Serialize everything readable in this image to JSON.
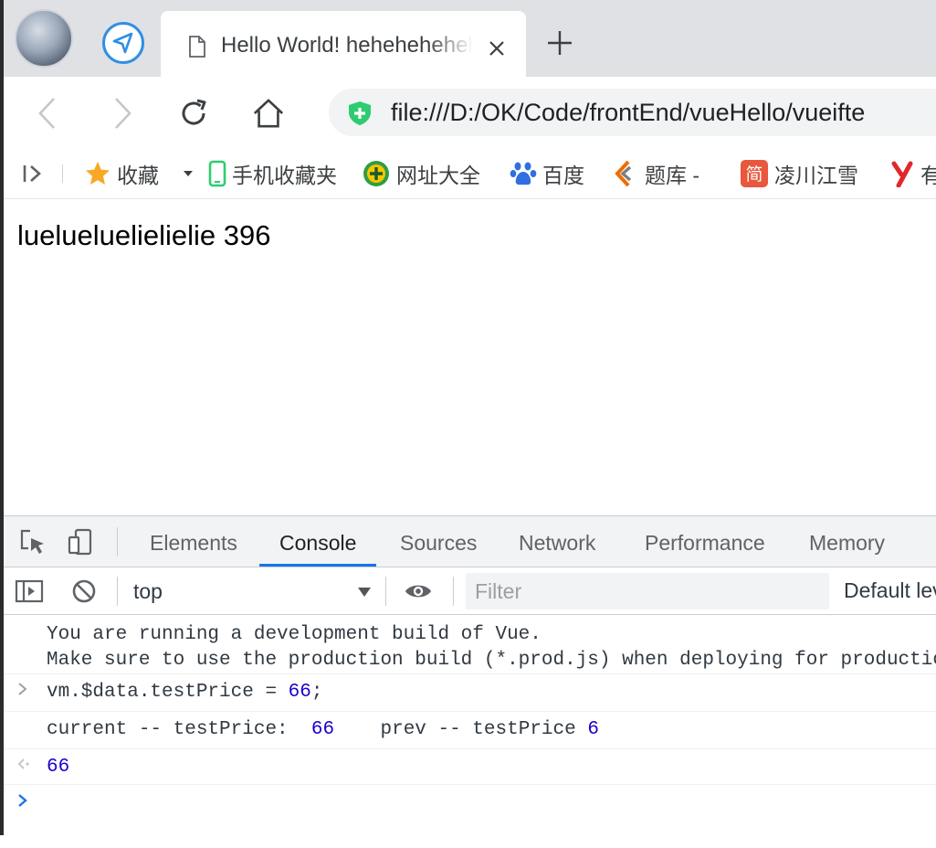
{
  "browser": {
    "tab": {
      "title": "Hello World! hehehehehehe"
    },
    "address_bar": {
      "url": "file:///D:/OK/Code/frontEnd/vueHello/vueifte"
    },
    "bookmarks": [
      {
        "label": "收藏",
        "icon": "star-icon"
      },
      {
        "label": "手机收藏夹",
        "icon": "phone-icon"
      },
      {
        "label": "网址大全",
        "icon": "globe-plus-icon"
      },
      {
        "label": "百度",
        "icon": "baidu-paw-icon"
      },
      {
        "label": "题库 -",
        "icon": "tiku-icon"
      },
      {
        "label": "凌川江雪",
        "icon": "jian-icon"
      },
      {
        "label": "有",
        "icon": "youdao-icon"
      }
    ],
    "colors": {
      "accent": "#1a73e8",
      "nav_blue": "#2f8fe6",
      "shield_green": "#2ecc71"
    }
  },
  "page": {
    "text": "luelueluelielielie 396"
  },
  "devtools": {
    "tabs": [
      "Elements",
      "Console",
      "Sources",
      "Network",
      "Performance",
      "Memory"
    ],
    "active_tab": "Console",
    "console_toolbar": {
      "context": "top",
      "filter_placeholder": "Filter",
      "levels": "Default levels"
    },
    "messages": {
      "warn_line1": "You are running a development build of Vue.",
      "warn_line2": "Make sure to use the production build (*.prod.js) when deploying for production.",
      "input_prefix": "vm.$data.testPrice = ",
      "input_value": "66",
      "input_suffix": ";",
      "log_a": "current -- testPrice:  ",
      "log_a_value": "66",
      "log_b": "    prev -- testPrice ",
      "log_b_value": "6",
      "result": "66"
    }
  }
}
